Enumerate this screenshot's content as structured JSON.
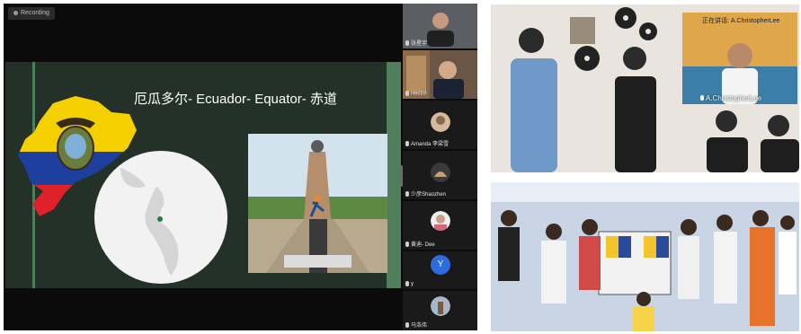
{
  "conference": {
    "recording_label": "Recording",
    "slide_title": "厄瓜多尔- Ecuador- Equator- 赤道",
    "participants": [
      {
        "name": "张星宇"
      },
      {
        "name": "Hector"
      },
      {
        "name": "Amanda 李梁雪"
      },
      {
        "name": "少彦Shaozhen"
      },
      {
        "name": "黄迪- Dee"
      },
      {
        "name": "y",
        "avatar_letter": "Y"
      },
      {
        "name": "马浩伟"
      }
    ]
  },
  "meeting_photo": {
    "speaking_indicator": "正在讲话: A.ChristopherLee",
    "speaker_name": "A.ChristopherLee"
  },
  "colors": {
    "slide_bg": "#243129",
    "slide_accent": "#4f7f5a",
    "avatar_blue": "#2d6cdf"
  }
}
